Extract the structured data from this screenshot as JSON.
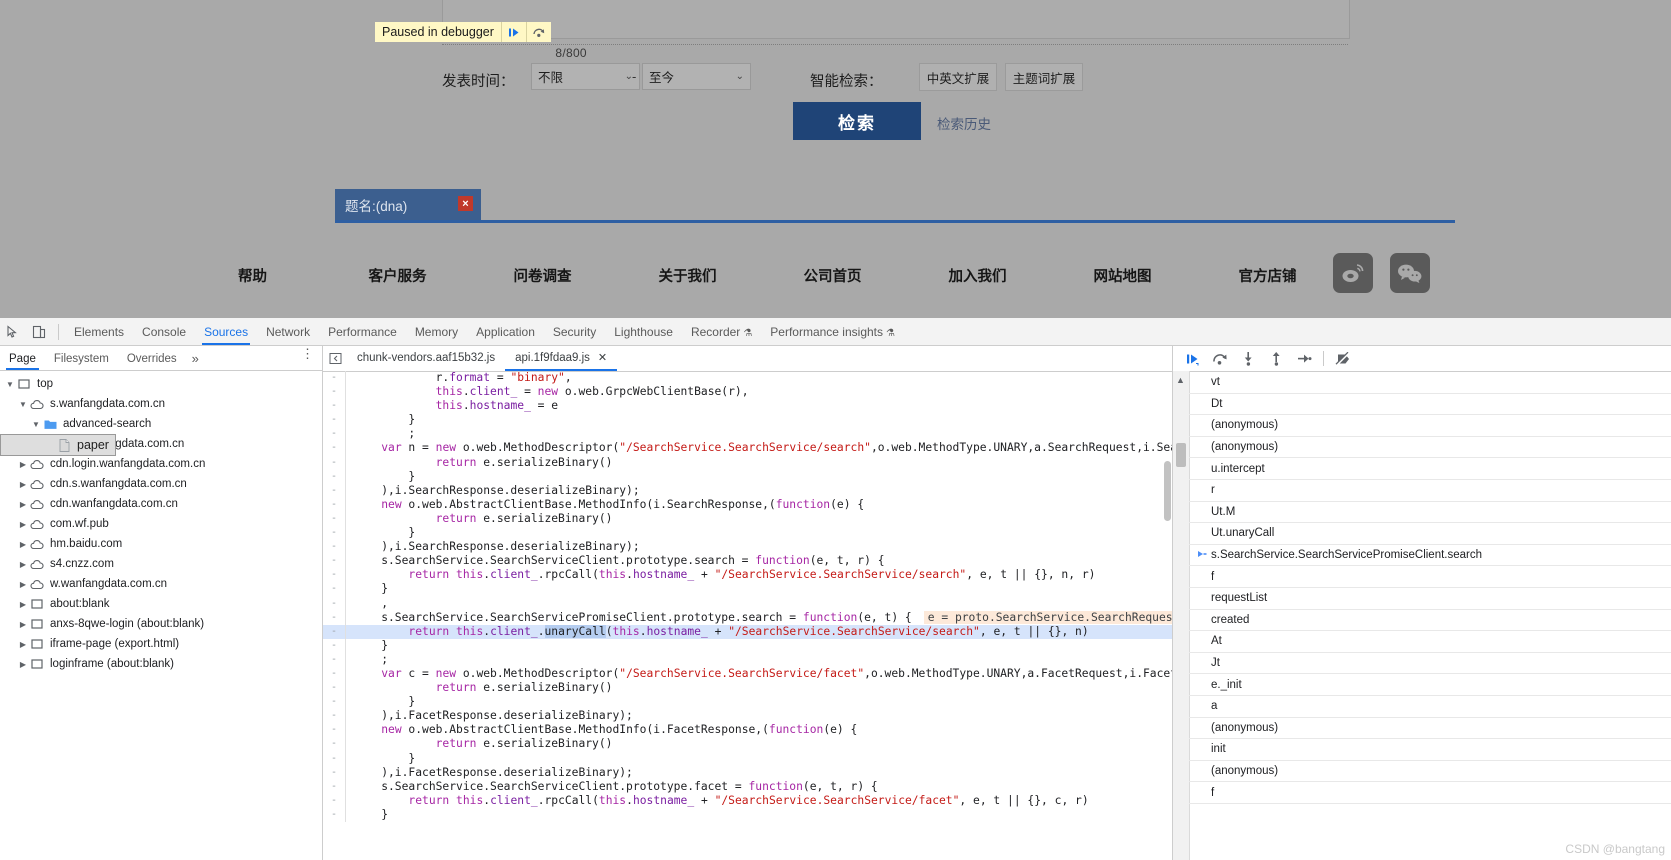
{
  "site": {
    "debugger_banner": {
      "label": "Paused in debugger",
      "resume_icon": "resume-icon",
      "step-over_icon": "step-over-icon"
    },
    "result_count": "8/800",
    "filters": {
      "date_label": "发表时间：",
      "date_from": "不限",
      "date_to": "至今",
      "dash": "-",
      "smart_label": "智能检索：",
      "tag_cn_en": "中英文扩展",
      "tag_subject": "主题词扩展"
    },
    "search_button": "检索",
    "search_history": "检索历史",
    "chip": {
      "label": "题名:(dna)",
      "close": "×"
    },
    "footer_nav": [
      "帮助",
      "客户服务",
      "问卷调查",
      "关于我们",
      "公司首页",
      "加入我们",
      "网站地图",
      "官方店铺"
    ],
    "social": [
      "weibo-icon",
      "wechat-icon"
    ]
  },
  "devtools": {
    "panel_tabs": [
      {
        "label": "Elements",
        "active": false
      },
      {
        "label": "Console",
        "active": false
      },
      {
        "label": "Sources",
        "active": true
      },
      {
        "label": "Network",
        "active": false
      },
      {
        "label": "Performance",
        "active": false
      },
      {
        "label": "Memory",
        "active": false
      },
      {
        "label": "Application",
        "active": false
      },
      {
        "label": "Security",
        "active": false
      },
      {
        "label": "Lighthouse",
        "active": false
      },
      {
        "label": "Recorder",
        "active": false,
        "flask": "⚗"
      },
      {
        "label": "Performance insights",
        "active": false,
        "flask": "⚗"
      }
    ],
    "navigator": {
      "tabs": [
        {
          "label": "Page",
          "active": true
        },
        {
          "label": "Filesystem",
          "active": false
        },
        {
          "label": "Overrides",
          "active": false
        }
      ],
      "more": "»",
      "kebab": "⋮",
      "tree": [
        {
          "label": "top",
          "indent": 0,
          "twisty": "▼",
          "icon": "frame-icon",
          "selected": false
        },
        {
          "label": "s.wanfangdata.com.cn",
          "indent": 1,
          "twisty": "▼",
          "icon": "cloud-icon",
          "selected": false
        },
        {
          "label": "advanced-search",
          "indent": 2,
          "twisty": "▼",
          "icon": "folder-icon",
          "selected": false
        },
        {
          "label": "paper",
          "indent": 3,
          "twisty": "",
          "icon": "file-icon",
          "selected": true
        },
        {
          "label": "apps.wanfangdata.com.cn",
          "indent": 1,
          "twisty": "▶",
          "icon": "cloud-icon",
          "selected": false
        },
        {
          "label": "cdn.login.wanfangdata.com.cn",
          "indent": 1,
          "twisty": "▶",
          "icon": "cloud-icon",
          "selected": false
        },
        {
          "label": "cdn.s.wanfangdata.com.cn",
          "indent": 1,
          "twisty": "▶",
          "icon": "cloud-icon",
          "selected": false
        },
        {
          "label": "cdn.wanfangdata.com.cn",
          "indent": 1,
          "twisty": "▶",
          "icon": "cloud-icon",
          "selected": false
        },
        {
          "label": "com.wf.pub",
          "indent": 1,
          "twisty": "▶",
          "icon": "cloud-icon",
          "selected": false
        },
        {
          "label": "hm.baidu.com",
          "indent": 1,
          "twisty": "▶",
          "icon": "cloud-icon",
          "selected": false
        },
        {
          "label": "s4.cnzz.com",
          "indent": 1,
          "twisty": "▶",
          "icon": "cloud-icon",
          "selected": false
        },
        {
          "label": "w.wanfangdata.com.cn",
          "indent": 1,
          "twisty": "▶",
          "icon": "cloud-icon",
          "selected": false
        },
        {
          "label": "about:blank",
          "indent": 1,
          "twisty": "▶",
          "icon": "frame-icon",
          "selected": false
        },
        {
          "label": "anxs-8qwe-login (about:blank)",
          "indent": 1,
          "twisty": "▶",
          "icon": "frame-icon",
          "selected": false
        },
        {
          "label": "iframe-page (export.html)",
          "indent": 1,
          "twisty": "▶",
          "icon": "frame-icon",
          "selected": false
        },
        {
          "label": "loginframe (about:blank)",
          "indent": 1,
          "twisty": "▶",
          "icon": "frame-icon",
          "selected": false
        }
      ]
    },
    "editor": {
      "tabs": [
        {
          "label": "chunk-vendors.aaf15b32.js",
          "active": false,
          "closable": false
        },
        {
          "label": "api.1f9fdaa9.js",
          "active": true,
          "closable": true,
          "close": "✕"
        }
      ],
      "lines": [
        {
          "gutter": "-",
          "text": "            r.format = \"binary\",",
          "hl": false
        },
        {
          "gutter": "-",
          "text": "            this.client_ = new o.web.GrpcWebClientBase(r),",
          "hl": false
        },
        {
          "gutter": "-",
          "text": "            this.hostname_ = e",
          "hl": false
        },
        {
          "gutter": "-",
          "text": "        }",
          "hl": false
        },
        {
          "gutter": "-",
          "text": "        ;",
          "hl": false
        },
        {
          "gutter": "-",
          "text": "    var n = new o.web.MethodDescriptor(\"/SearchService.SearchService/search\",o.web.MethodType.UNARY,a.SearchRequest,i.SearchRe",
          "hl": false
        },
        {
          "gutter": "-",
          "text": "            return e.serializeBinary()",
          "hl": false
        },
        {
          "gutter": "-",
          "text": "        }",
          "hl": false
        },
        {
          "gutter": "-",
          "text": "    ),i.SearchResponse.deserializeBinary);",
          "hl": false
        },
        {
          "gutter": "-",
          "text": "    new o.web.AbstractClientBase.MethodInfo(i.SearchResponse,(function(e) {",
          "hl": false
        },
        {
          "gutter": "-",
          "text": "            return e.serializeBinary()",
          "hl": false
        },
        {
          "gutter": "-",
          "text": "        }",
          "hl": false
        },
        {
          "gutter": "-",
          "text": "    ),i.SearchResponse.deserializeBinary);",
          "hl": false
        },
        {
          "gutter": "-",
          "text": "    s.SearchService.SearchServiceClient.prototype.search = function(e, t, r) {",
          "hl": false
        },
        {
          "gutter": "-",
          "text": "        return this.client_.rpcCall(this.hostname_ + \"/SearchService.SearchService/search\", e, t || {}, n, r)",
          "hl": false
        },
        {
          "gutter": "-",
          "text": "    }",
          "hl": false
        },
        {
          "gutter": "-",
          "text": "    ,",
          "hl": false
        },
        {
          "gutter": "-",
          "text": "    s.SearchService.SearchServicePromiseClient.prototype.search = function(e, t) {",
          "hl": false,
          "hint": "e = proto.SearchService.SearchRequest {wr"
        },
        {
          "gutter": "-",
          "text": "        return this.client_.unaryCall(this.hostname_ + \"/SearchService.SearchService/search\", e, t || {}, n)",
          "hl": true,
          "selection": "unaryCall"
        },
        {
          "gutter": "-",
          "text": "    }",
          "hl": false
        },
        {
          "gutter": "-",
          "text": "    ;",
          "hl": false
        },
        {
          "gutter": "-",
          "text": "    var c = new o.web.MethodDescriptor(\"/SearchService.SearchService/facet\",o.web.MethodType.UNARY,a.FacetRequest,i.FacetRespo",
          "hl": false
        },
        {
          "gutter": "-",
          "text": "            return e.serializeBinary()",
          "hl": false
        },
        {
          "gutter": "-",
          "text": "        }",
          "hl": false
        },
        {
          "gutter": "-",
          "text": "    ),i.FacetResponse.deserializeBinary);",
          "hl": false
        },
        {
          "gutter": "-",
          "text": "    new o.web.AbstractClientBase.MethodInfo(i.FacetResponse,(function(e) {",
          "hl": false
        },
        {
          "gutter": "-",
          "text": "            return e.serializeBinary()",
          "hl": false
        },
        {
          "gutter": "-",
          "text": "        }",
          "hl": false
        },
        {
          "gutter": "-",
          "text": "    ),i.FacetResponse.deserializeBinary);",
          "hl": false
        },
        {
          "gutter": "-",
          "text": "    s.SearchService.SearchServiceClient.prototype.facet = function(e, t, r) {",
          "hl": false
        },
        {
          "gutter": "-",
          "text": "        return this.client_.rpcCall(this.hostname_ + \"/SearchService.SearchService/facet\", e, t || {}, c, r)",
          "hl": false
        },
        {
          "gutter": "-",
          "text": "    }",
          "hl": false
        }
      ]
    },
    "debugger": {
      "toolbar": [
        {
          "name": "resume-script-execution",
          "icon": "resume-icon"
        },
        {
          "name": "step-over-next-function-call",
          "icon": "step-over-icon"
        },
        {
          "name": "step-into-next-function-call",
          "icon": "step-into-icon"
        },
        {
          "name": "step-out-of-current-function",
          "icon": "step-out-icon"
        },
        {
          "name": "step",
          "icon": "step-icon"
        },
        {
          "name": "deactivate-breakpoints",
          "icon": "deactivate-breakpoints-icon"
        }
      ],
      "call_stack": [
        {
          "label": "vt",
          "current": false
        },
        {
          "label": "Dt",
          "current": false
        },
        {
          "label": "(anonymous)",
          "current": false
        },
        {
          "label": "(anonymous)",
          "current": false
        },
        {
          "label": "u.intercept",
          "current": false
        },
        {
          "label": "r",
          "current": false
        },
        {
          "label": "Ut.M",
          "current": false
        },
        {
          "label": "Ut.unaryCall",
          "current": false
        },
        {
          "label": "s.SearchService.SearchServicePromiseClient.search",
          "current": true
        },
        {
          "label": "f",
          "current": false
        },
        {
          "label": "requestList",
          "current": false
        },
        {
          "label": "created",
          "current": false
        },
        {
          "label": "At",
          "current": false
        },
        {
          "label": "Jt",
          "current": false
        },
        {
          "label": "e._init",
          "current": false
        },
        {
          "label": "a",
          "current": false
        },
        {
          "label": "(anonymous)",
          "current": false
        },
        {
          "label": "init",
          "current": false
        },
        {
          "label": "(anonymous)",
          "current": false
        },
        {
          "label": "f",
          "current": false
        }
      ]
    }
  },
  "watermark": "CSDN @bangtang"
}
